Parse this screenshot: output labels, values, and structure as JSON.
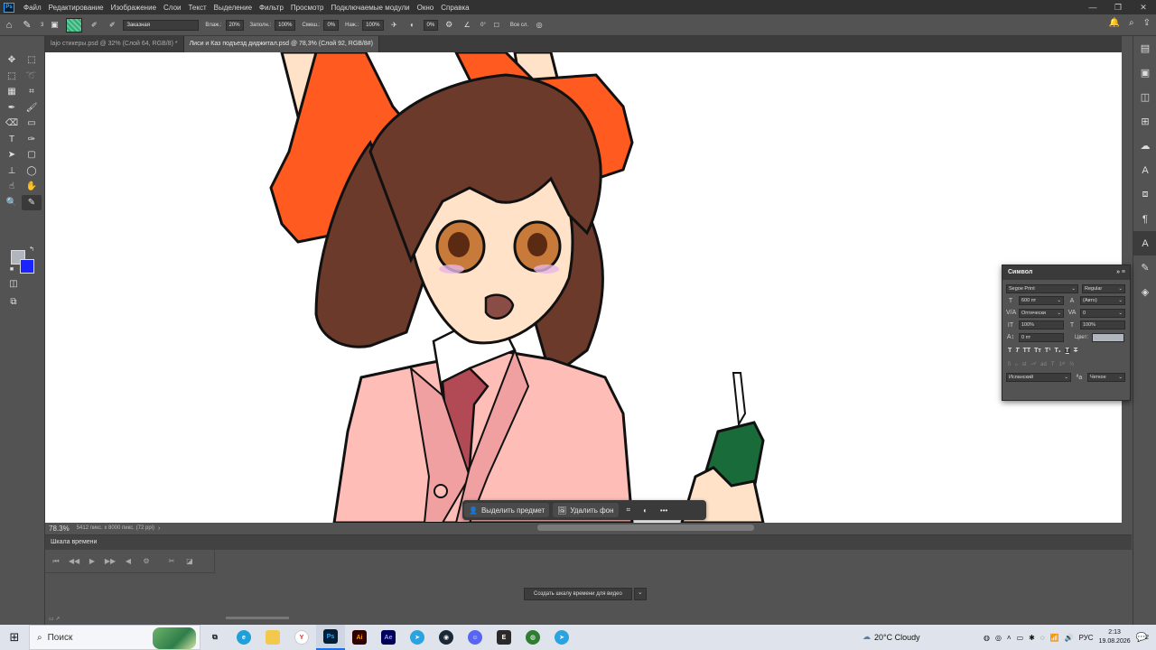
{
  "menubar": {
    "logo": "Ps",
    "items": [
      "Файл",
      "Редактирование",
      "Изображение",
      "Слои",
      "Текст",
      "Выделение",
      "Фильтр",
      "Просмотр",
      "Подключаемые модули",
      "Окно",
      "Справка"
    ],
    "win_controls": [
      "—",
      "❐",
      "✕"
    ]
  },
  "optbar": {
    "brush_size": "3",
    "mode": "Заказная",
    "wetness_label": "Влаж.:",
    "wetness": "20%",
    "load_label": "Заполн.:",
    "load": "100%",
    "mix_label": "Смеш.:",
    "mix": "0%",
    "flow_label": "Наж.:",
    "flow": "100%",
    "smoothing": "0%",
    "angle": "0°",
    "all_layers": "Все сл."
  },
  "tabs": [
    {
      "label": "lajo стикеры.psd @ 32% (Слой 64, RGB/8) *",
      "active": false
    },
    {
      "label": "Лиси и Каз подъезд диджитал.psd @ 78,3% (Слой 92, RGB/8#)",
      "active": true
    }
  ],
  "status": {
    "zoom": "78.3%",
    "doc_info": "5412 пикс. x 8000 пикс. (72 ppi)"
  },
  "context_bar": {
    "select_subject": "Выделить предмет",
    "remove_bg": "Удалить фон"
  },
  "timeline": {
    "title": "Шкала времени",
    "create_button": "Создать шкалу времени для видео"
  },
  "char_panel": {
    "title": "Символ",
    "font_family": "Segoe Print",
    "font_style": "Regular",
    "size": "600 пт",
    "leading": "(Авто)",
    "kerning": "Оптически",
    "tracking": "0",
    "vscale": "100%",
    "hscale": "100%",
    "baseline": "0 пт",
    "color_label": "Цвет:",
    "text_color": "#b1b5bd",
    "language": "Испанский",
    "antialias": "Четкое"
  },
  "colors": {
    "foreground": "#b1b5bd",
    "background": "#1a24ff"
  },
  "taskbar": {
    "search_placeholder": "Поиск",
    "weather": "20°C  Cloudy",
    "lang": "РУС",
    "time": "2:13",
    "date": "19.08.2026",
    "notifications": "2"
  }
}
